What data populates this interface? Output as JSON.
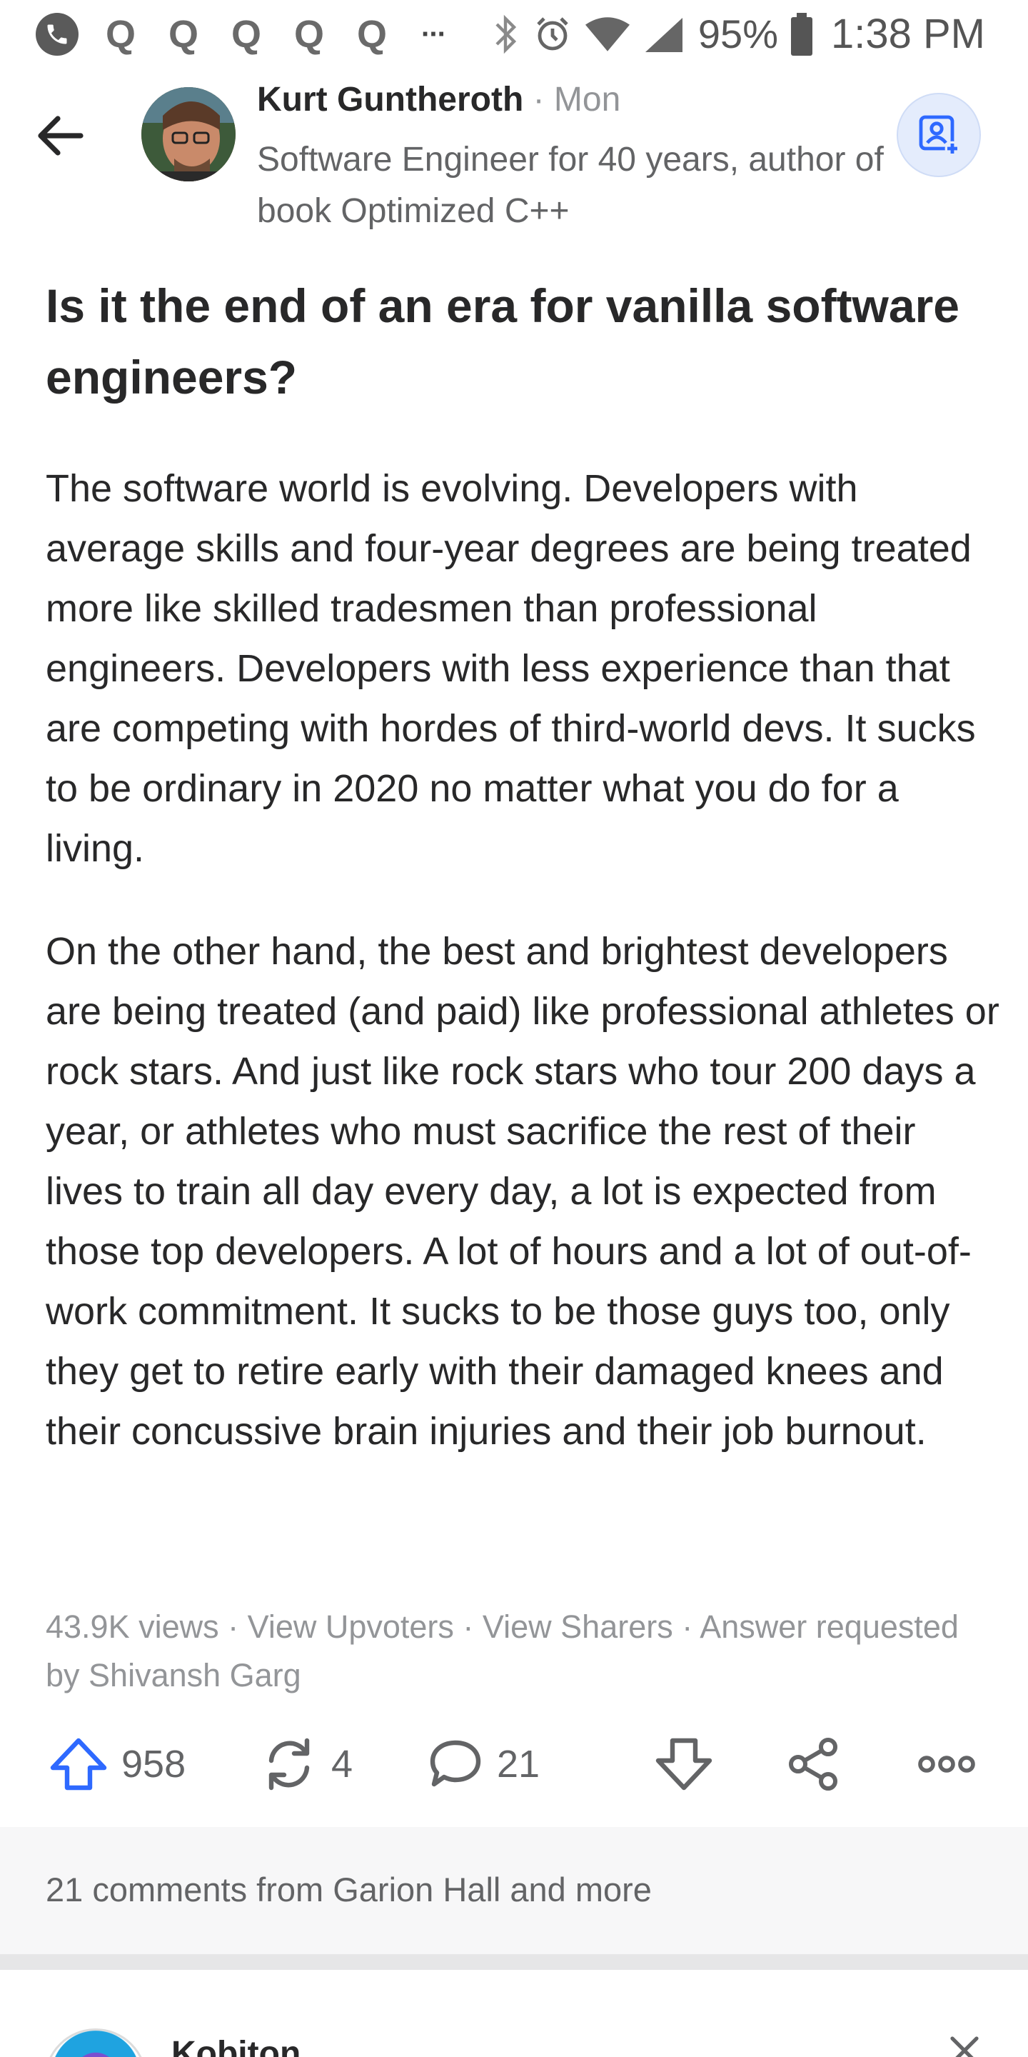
{
  "status_bar": {
    "battery": "95%",
    "time": "1:38 PM",
    "notification_letters": [
      "Q",
      "Q",
      "Q",
      "Q",
      "Q"
    ],
    "more_glyph": "···",
    "icons": [
      "phone-icon",
      "bluetooth-icon",
      "alarm-icon",
      "wifi-icon",
      "signal-icon",
      "battery-icon"
    ]
  },
  "header": {
    "author_name": "Kurt Guntheroth",
    "separator": " · ",
    "date": "Mon",
    "credential": "Software Engineer for 40 years, author of book Optimized C++"
  },
  "question": {
    "title": "Is it the end of an era for vanilla software engineers?"
  },
  "answer": {
    "paragraphs": [
      "The software world is evolving. Developers with average skills and four-year degrees are being treated more like skilled tradesmen than professional engineers. Developers with less experience than that are competing with hordes of third-world devs. It sucks to be ordinary in 2020 no matter what you do for a living.",
      "On the other hand, the best and brightest developers are being treated (and paid) like professional athletes or rock stars. And just like rock stars who tour 200 days a year, or athletes who must sacrifice the rest of their lives to train all day every day, a lot is expected from those top developers. A lot of hours and a lot of out-of-work commitment. It sucks to be those guys too, only they get to retire early with their damaged knees and their concussive brain injuries and their job burnout."
    ]
  },
  "meta": {
    "views": "43.9K views",
    "sep": " · ",
    "view_upvoters": "View Upvoters",
    "view_sharers": "View Sharers",
    "requested": "Answer requested by Shivansh Garg"
  },
  "actions": {
    "upvotes": "958",
    "shares": "4",
    "comments": "21",
    "accent_color": "#2e69ff"
  },
  "comments_preview": {
    "text": "21 comments from Garion Hall and more"
  },
  "next_item": {
    "name": "Kobiton"
  }
}
